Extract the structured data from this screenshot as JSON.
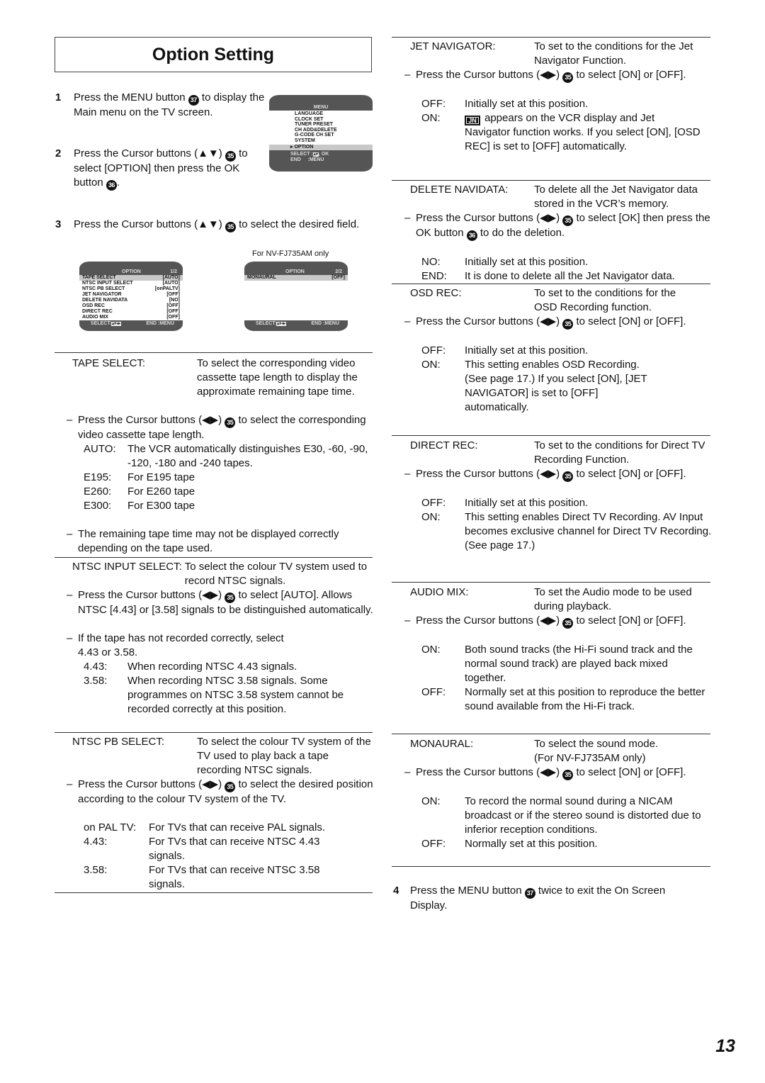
{
  "title": "Option Setting",
  "page_number": "13",
  "steps": [
    {
      "num": "1",
      "pre": "Press the MENU button ",
      "btn": "37",
      "post": " to display the Main menu on the TV screen."
    },
    {
      "num": "2",
      "pre": "Press the Cursor buttons (▲▼) ",
      "btn": "35",
      "post": " to select [OPTION] then press the OK button ",
      "btn2": "36",
      "post2": "."
    },
    {
      "num": "3",
      "pre": "Press the Cursor buttons (▲▼) ",
      "btn": "35",
      "post": " to select the desired field."
    },
    {
      "num": "4",
      "pre": "Press the MENU button ",
      "btn": "37",
      "post": " twice to exit the On Screen Display."
    }
  ],
  "main_menu_screen": {
    "header": "MENU",
    "items": [
      "LANGUAGE",
      "CLOCK SET",
      "TUNER PRESET",
      "CH ADD&DELETE",
      "G-CODE CH SET",
      "SYSTEM",
      "▸ OPTION"
    ],
    "selected_index": 6,
    "footer_select": "SELECT :",
    "footer_select_suffix": ", OK",
    "footer_end": "END     :MENU"
  },
  "option_screen_1": {
    "header": "OPTION",
    "page": "1/2",
    "rows": [
      {
        "label": "TAPE SELECT",
        "value": "[AUTO]"
      },
      {
        "label": "NTSC INPUT SELECT",
        "value": "[AUTO]"
      },
      {
        "label": "NTSC PB SELECT",
        "value": "[onPALTV]"
      },
      {
        "label": "JET NAVIGATOR",
        "value": "[OFF]"
      },
      {
        "label": "DELETE NAVIDATA",
        "value": "[NO]"
      },
      {
        "label": "OSD REC",
        "value": "[OFF]"
      },
      {
        "label": "DIRECT REC",
        "value": "[OFF]"
      },
      {
        "label": "AUDIO MIX",
        "value": "[OFF]"
      }
    ],
    "selected_index": 0,
    "footer_select": "SELECT:",
    "footer_end": "END :MENU"
  },
  "option_screen_2": {
    "caption": "For NV-FJ735AM only",
    "header": "OPTION",
    "page": "2/2",
    "rows": [
      {
        "label": "MONAURAL",
        "value": "[OFF]"
      }
    ],
    "selected_index": 0,
    "footer_select": "SELECT:",
    "footer_end": "END :MENU"
  },
  "icons": {
    "jet_navigator_display": "JN"
  },
  "left_sections": [
    {
      "label": "TAPE SELECT:",
      "desc": "To select the corresponding video cassette tape length to display the approximate remaining tape time.",
      "bullets": [
        {
          "pre": "Press the Cursor buttons (◀▶) ",
          "btn": "35",
          "post": " to select the corresponding video cassette tape length."
        }
      ],
      "options": [
        {
          "k": "AUTO:",
          "v": "The VCR automatically distinguishes E30, -60, -90, -120, -180 and -240 tapes."
        },
        {
          "k": "E195:",
          "v": "For E195 tape"
        },
        {
          "k": "E260:",
          "v": "For E260 tape"
        },
        {
          "k": "E300:",
          "v": "For E300 tape"
        }
      ],
      "note": "The remaining tape time may not be displayed correctly depending on the tape used."
    },
    {
      "label": "NTSC INPUT SELECT:",
      "desc": "To select the colour TV system used to record NTSC signals.",
      "bullet": {
        "pre": "Press the Cursor buttons (◀▶) ",
        "btn": "35",
        "post": " to select [AUTO]. Allows NTSC [4.43] or [3.58] signals to be distinguished automatically."
      },
      "bullet2": "If the tape has not recorded correctly, select 4.43 or 3.58.",
      "options": [
        {
          "k": "4.43:",
          "v": "When recording NTSC 4.43 signals."
        },
        {
          "k": "3.58:",
          "v": "When recording NTSC 3.58 signals. Some programmes on NTSC 3.58 system cannot be recorded correctly at this position."
        }
      ]
    },
    {
      "label": "NTSC PB SELECT:",
      "desc": "To select the colour TV system of the TV used to play back a tape recording NTSC signals.",
      "bullet": {
        "pre": "Press the Cursor buttons (◀▶) ",
        "btn": "35",
        "post": " to select the desired position according to the colour TV system of the TV."
      },
      "options": [
        {
          "k": "on PAL TV:",
          "v": "For TVs that can receive PAL signals."
        },
        {
          "k": "4.43:",
          "v": "For TVs that can receive NTSC 4.43 signals."
        },
        {
          "k": "3.58:",
          "v": "For TVs that can receive NTSC 3.58 signals."
        }
      ]
    }
  ],
  "right_sections": [
    {
      "label": "JET NAVIGATOR:",
      "desc": "To set to the conditions for the Jet Navigator Function.",
      "bullet": {
        "pre": "Press the Cursor buttons (◀▶) ",
        "btn": "35",
        "post": " to select [ON] or [OFF]."
      },
      "options": [
        {
          "k": "OFF:",
          "v": "Initially set at this position."
        },
        {
          "k": "ON:",
          "v": "appears on the VCR display and Jet Navigator function works. If you select [ON], [OSD REC] is set to [OFF] automatically."
        }
      ]
    },
    {
      "label": "DELETE NAVIDATA:",
      "desc": "To delete all the Jet Navigator data stored in the VCR’s memory.",
      "bullet": {
        "pre": "Press the Cursor buttons (◀▶) ",
        "btn": "35",
        "post": " to select [OK] then press the OK button ",
        "btn2": "36",
        "post2": " to do the deletion."
      },
      "options": [
        {
          "k": "NO:",
          "v": "Initially set at this position."
        },
        {
          "k": "END:",
          "v": "It is done to delete all the Jet Navigator data."
        }
      ]
    },
    {
      "label": "OSD REC:",
      "desc": "To set to the conditions for the OSD Recording function.",
      "bullet": {
        "pre": "Press the Cursor buttons (◀▶) ",
        "btn": "35",
        "post": " to select [ON] or [OFF]."
      },
      "options": [
        {
          "k": "OFF:",
          "v": "Initially set at this position."
        },
        {
          "k": "ON:",
          "v": "This setting enables OSD Recording. (See page 17.) If you select [ON], [JET NAVIGATOR] is set to [OFF] automatically."
        }
      ]
    },
    {
      "label": "DIRECT REC:",
      "desc": "To set to the conditions for Direct TV Recording Function.",
      "bullet": {
        "pre": "Press the Cursor buttons (◀▶) ",
        "btn": "35",
        "post": " to select [ON] or [OFF]."
      },
      "options": [
        {
          "k": "OFF:",
          "v": "Initially set at this position."
        },
        {
          "k": "ON:",
          "v": "This setting enables Direct TV Recording. AV Input  becomes exclusive channel for Direct TV Recording. (See page 17.)"
        }
      ]
    },
    {
      "label": "AUDIO MIX:",
      "desc": "To set the Audio mode to be used during playback.",
      "bullet": {
        "pre": "Press the Cursor buttons (◀▶) ",
        "btn": "35",
        "post": " to select [ON] or [OFF]."
      },
      "options": [
        {
          "k": "ON:",
          "v": "Both sound tracks (the Hi-Fi sound track and the normal sound track) are played back mixed together."
        },
        {
          "k": "OFF:",
          "v": "Normally set at this position to reproduce the better sound available from the Hi-Fi track."
        }
      ]
    },
    {
      "label": "MONAURAL:",
      "desc": "To select the sound mode. (For NV-FJ735AM only)",
      "bullet": {
        "pre": "Press the Cursor buttons (◀▶) ",
        "btn": "35",
        "post": " to select [ON] or [OFF]."
      },
      "options": [
        {
          "k": "ON:",
          "v": "To record the normal sound during a NICAM broadcast or if the stereo sound is distorted due to inferior reception conditions."
        },
        {
          "k": "OFF:",
          "v": "Normally set at this position."
        }
      ]
    }
  ],
  "dash": "–"
}
